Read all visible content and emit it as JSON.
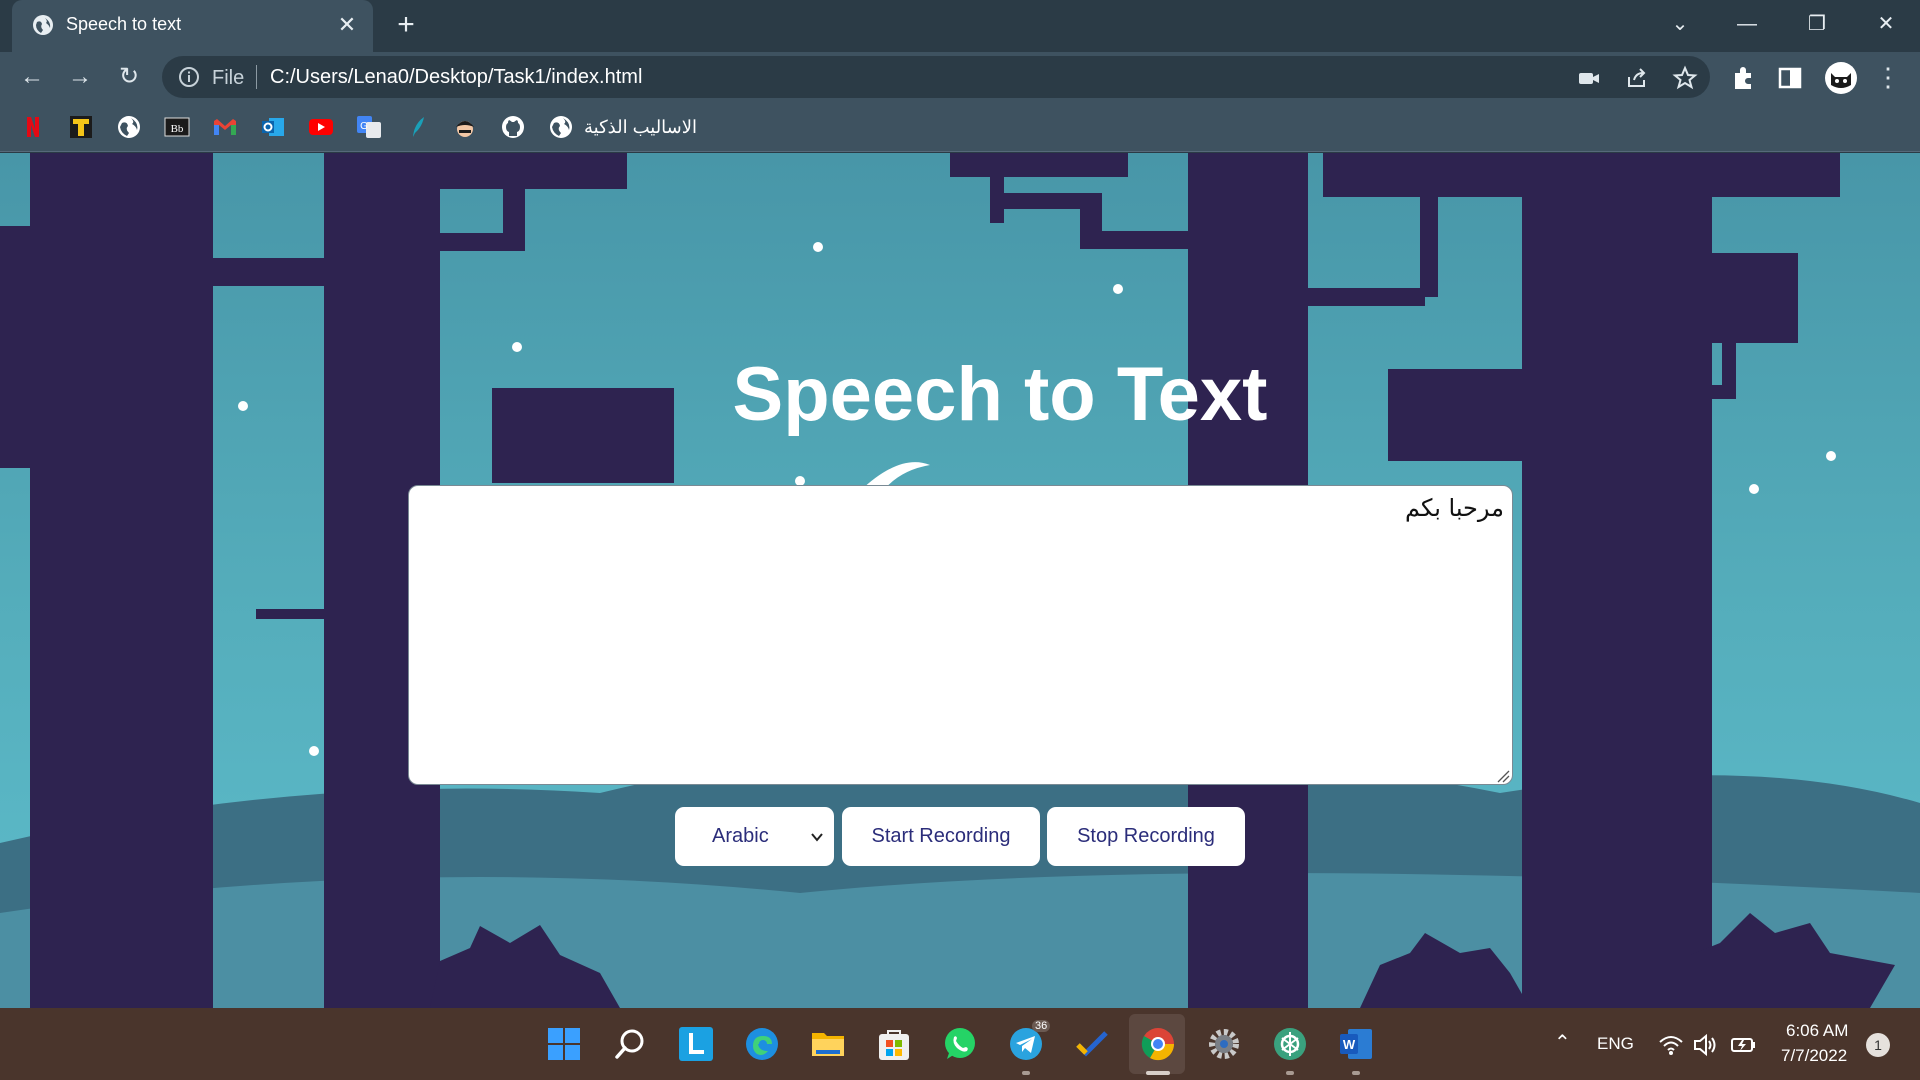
{
  "browser": {
    "tab_title": "Speech to text",
    "address_scheme": "File",
    "address_url": "C:/Users/Lena0/Desktop/Task1/index.html",
    "bookmark_label": "الاساليب الذكية",
    "bookmarks_icons": [
      "netflix-icon",
      "t-icon",
      "globe-icon",
      "blackboard-icon",
      "gmail-icon",
      "outlook-icon",
      "youtube-icon",
      "google-translate-icon",
      "feather-icon",
      "avatar-icon",
      "github-icon",
      "globe-icon"
    ]
  },
  "page": {
    "heading": "Speech to Text",
    "transcript": "مرحبا بكم",
    "language_selected": "Arabic",
    "start_label": "Start Recording",
    "stop_label": "Stop Recording"
  },
  "taskbar": {
    "apps": [
      "windows-start-icon",
      "search-icon",
      "lens-app-icon",
      "edge-icon",
      "file-explorer-icon",
      "store-icon",
      "whatsapp-icon",
      "telegram-icon",
      "todo-icon",
      "chrome-icon",
      "settings-icon",
      "chatgpt-icon",
      "word-icon"
    ],
    "telegram_badge": "36",
    "language": "ENG",
    "time": "6:06 AM",
    "date": "7/7/2022",
    "notification_count": "1"
  },
  "colors": {
    "chrome_dark": "#2b3b46",
    "chrome_mid": "#3e5260",
    "sky": "#4f9fb0",
    "trees": "#2e2350",
    "button_text": "#2b2d7a",
    "taskbar": "#4a352c"
  }
}
